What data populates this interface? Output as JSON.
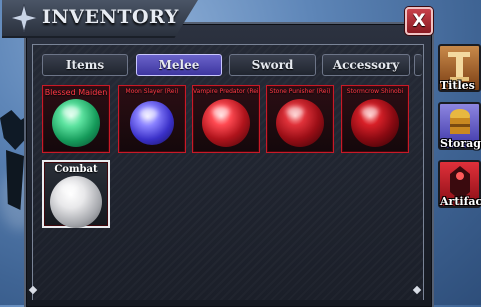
{
  "window": {
    "title": "INVENTORY",
    "close_label": "X"
  },
  "tabs": [
    {
      "label": "Items",
      "active": false
    },
    {
      "label": "Melee",
      "active": true
    },
    {
      "label": "Sword",
      "active": false
    },
    {
      "label": "Accessory",
      "active": false
    }
  ],
  "items": [
    {
      "name": "Blessed Maiden",
      "orb_color": "#2fcf7a",
      "border": "red"
    },
    {
      "name": "Moon Slayer (Rei)",
      "orb_color": "#5a52e0",
      "border": "red"
    },
    {
      "name": "Vampire Predator (Rei)",
      "orb_color": "#d8262e",
      "border": "red"
    },
    {
      "name": "Stone Punisher (Rei)",
      "orb_color": "#c81e28",
      "border": "red"
    },
    {
      "name": "Stormcrow Shinobi",
      "orb_color": "#c8141e",
      "border": "red"
    },
    {
      "name": "Combat",
      "orb_color": "#e6e6e6",
      "border": "white"
    }
  ],
  "side_menu": [
    {
      "label": "Titles",
      "icon": "trophy-icon"
    },
    {
      "label": "Storage",
      "icon": "chest-icon"
    },
    {
      "label": "Artifact",
      "icon": "armor-icon"
    }
  ],
  "colors": {
    "accent": "#4a43b5",
    "slot_border_red": "#c81a28",
    "close_red": "#b0303a"
  }
}
